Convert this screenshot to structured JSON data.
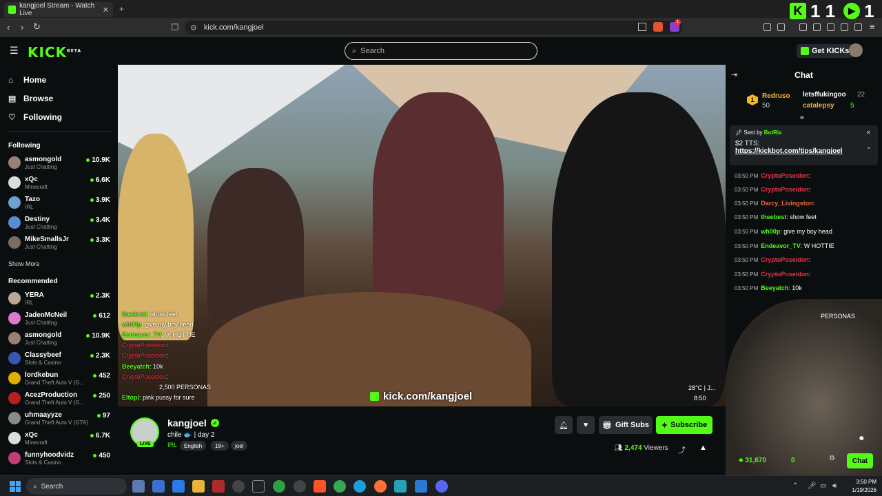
{
  "browser": {
    "tab_title": "kangjoel Stream - Watch Live",
    "tab_close": "✕",
    "new_tab": "+",
    "url": "kick.com/kangjoel",
    "notif_count": "1"
  },
  "overlay": {
    "left_text": "1 1",
    "right_text": "1"
  },
  "header": {
    "logo": "KICK",
    "beta": "BETA",
    "search_placeholder": "Search",
    "get_kicks": "Get KICKs"
  },
  "sidebar": {
    "nav": [
      {
        "label": "Home",
        "icon": "home-icon"
      },
      {
        "label": "Browse",
        "icon": "browse-icon"
      },
      {
        "label": "Following",
        "icon": "heart-icon"
      }
    ],
    "following_title": "Following",
    "following": [
      {
        "name": "asmongold",
        "category": "Just Chatting",
        "viewers": "10.9K"
      },
      {
        "name": "xQc",
        "category": "Minecraft",
        "viewers": "6.6K"
      },
      {
        "name": "Tazo",
        "category": "IRL",
        "viewers": "3.9K"
      },
      {
        "name": "Destiny",
        "category": "Just Chatting",
        "viewers": "3.4K"
      },
      {
        "name": "MikeSmallsJr",
        "category": "Just Chatting",
        "viewers": "3.3K"
      }
    ],
    "show_more": "Show More",
    "recommended_title": "Recommended",
    "recommended": [
      {
        "name": "YERA",
        "category": "IRL",
        "viewers": "2.3K"
      },
      {
        "name": "JadenMcNeil",
        "category": "Just Chatting",
        "viewers": "612"
      },
      {
        "name": "asmongold",
        "category": "Just Chatting",
        "viewers": "10.9K"
      },
      {
        "name": "Classybeef",
        "category": "Slots & Casino",
        "viewers": "2.3K"
      },
      {
        "name": "lordkebun",
        "category": "Grand Theft Auto V (G...",
        "viewers": "452"
      },
      {
        "name": "AcezProduction",
        "category": "Grand Theft Auto V (G...",
        "viewers": "250"
      },
      {
        "name": "uhmaayyze",
        "category": "Grand Theft Auto V (GTA)",
        "viewers": "97"
      },
      {
        "name": "xQc",
        "category": "Minecraft",
        "viewers": "6.7K"
      },
      {
        "name": "funnyhoodvidz",
        "category": "Slots & Casino",
        "viewers": "450"
      }
    ]
  },
  "video": {
    "watermark": "kick.com/kangjoel",
    "temp": "28°C | J...",
    "time": "8:50",
    "overlay_chat": [
      {
        "user": "theebest",
        "text": "show feet",
        "color": "green"
      },
      {
        "user": "wh00p",
        "text": "give my boy head",
        "color": "green"
      },
      {
        "user": "Endeavor_TV",
        "text": "W HOTTIE",
        "color": "green"
      },
      {
        "user": "CryptoPoseidon",
        "text": ":",
        "color": "red"
      },
      {
        "user": "CryptoPoseidon",
        "text": ":",
        "color": "red"
      },
      {
        "user": "Beeyatch",
        "text": "10k",
        "color": "green"
      },
      {
        "user": "CryptoPoseidon",
        "text": ":",
        "color": "red"
      },
      {
        "user": "",
        "text": "2,500 PERSONAS",
        "color": "green"
      },
      {
        "user": "Eltopl",
        "text": "pink pussy for sure",
        "color": "green"
      }
    ]
  },
  "stream": {
    "channel": "kangjoel",
    "live": "LIVE",
    "title": "chile 🐟 | day 2",
    "category": "IRL",
    "tags": [
      "English",
      "18+",
      "joel"
    ],
    "gift_subs": "Gift Subs",
    "subscribe": "Subscribe",
    "viewers": "2,474",
    "viewers_label": "Viewers"
  },
  "chat": {
    "title": "Chat",
    "leaderboard": [
      {
        "rank": "1",
        "name": "Redruso",
        "score": "50"
      },
      {
        "name": "letsffukingoo",
        "score": "22"
      },
      {
        "name": "catalepsy",
        "score": "5"
      }
    ],
    "pinned": {
      "sent_by": "Sent by",
      "bot": "BotRix",
      "message": "$2 TTS:",
      "link": "https://kickbot.com/tips/kangjoel"
    },
    "messages": [
      {
        "time": "03:50 PM",
        "user": "CryptoPoseidon",
        "text": ":",
        "color": "r"
      },
      {
        "time": "03:50 PM",
        "user": "CryptoPoseidon",
        "text": ":",
        "color": "r"
      },
      {
        "time": "03:50 PM",
        "user": "Darcy_Livingston",
        "text": ":",
        "color": "o"
      },
      {
        "time": "03:50 PM",
        "user": "theebest",
        "text": "show feet",
        "color": "g"
      },
      {
        "time": "03:50 PM",
        "user": "wh00p",
        "text": "give my boy head",
        "color": "g"
      },
      {
        "time": "03:50 PM",
        "user": "Endeavor_TV",
        "text": "W HOTTIE",
        "color": "g"
      },
      {
        "time": "03:50 PM",
        "user": "CryptoPoseidon",
        "text": ":",
        "color": "r"
      },
      {
        "time": "03:50 PM",
        "user": "CryptoPoseidon",
        "text": ":",
        "color": "r"
      },
      {
        "time": "03:50 PM",
        "user": "Beeyatch",
        "text": "10k",
        "color": "g"
      }
    ],
    "personas": "PERSONAS",
    "kicks_balance": "31,670",
    "zero": "0",
    "chat_button": "Chat"
  },
  "taskbar": {
    "search": "Search",
    "time": "3:50 PM",
    "date": "1/19/2026"
  }
}
